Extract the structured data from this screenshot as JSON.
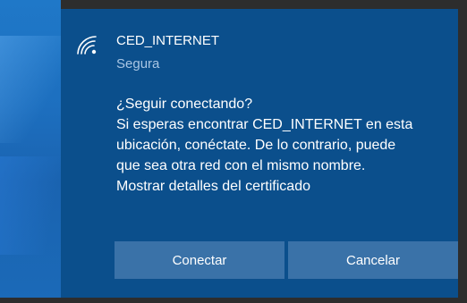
{
  "network": {
    "ssid": "CED_INTERNET",
    "security": "Segura"
  },
  "prompt": {
    "question": "¿Seguir conectando?",
    "line1": "Si esperas encontrar CED_INTERNET en esta",
    "line2": "ubicación, conéctate. De lo contrario, puede",
    "line3": "que sea otra red con el mismo nombre.",
    "line4": "Mostrar detalles del certificado"
  },
  "buttons": {
    "connect": "Conectar",
    "cancel": "Cancelar"
  },
  "icons": {
    "network": "wifi-icon"
  },
  "colors": {
    "flyout_bg": "#0b4f8c",
    "button_bg": "#3a72a8",
    "secondary_text": "#a9c6e4"
  }
}
